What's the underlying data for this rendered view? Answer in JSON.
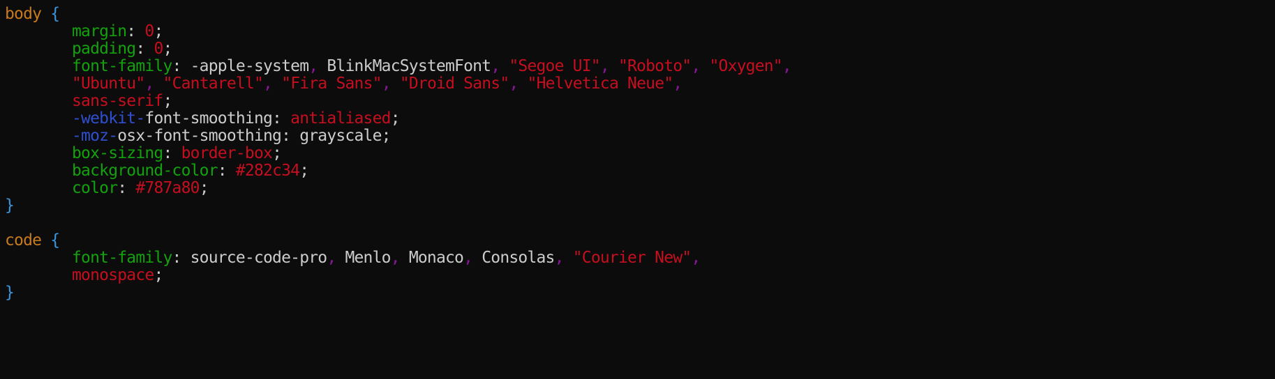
{
  "editor": {
    "background": "#0c0c0c",
    "palette": {
      "sel": "#c87a1e",
      "brace": "#3a96dd",
      "prop": "#13a10e",
      "val": "#c50f1f",
      "plain": "#cccccc",
      "vendor": "#2f4fd0",
      "comma": "#881798"
    },
    "lines": [
      {
        "indent": 0,
        "tokens": [
          [
            "sel",
            "body"
          ],
          [
            "plain",
            " "
          ],
          [
            "brace",
            "{"
          ]
        ]
      },
      {
        "indent": 1,
        "tokens": [
          [
            "prop",
            "margin"
          ],
          [
            "plain",
            ": "
          ],
          [
            "val",
            "0"
          ],
          [
            "plain",
            ";"
          ]
        ]
      },
      {
        "indent": 1,
        "tokens": [
          [
            "prop",
            "padding"
          ],
          [
            "plain",
            ": "
          ],
          [
            "val",
            "0"
          ],
          [
            "plain",
            ";"
          ]
        ]
      },
      {
        "indent": 1,
        "tokens": [
          [
            "prop",
            "font-family"
          ],
          [
            "plain",
            ": -apple-system"
          ],
          [
            "comma",
            ","
          ],
          [
            "plain",
            " BlinkMacSystemFont"
          ],
          [
            "comma",
            ","
          ],
          [
            "plain",
            " "
          ],
          [
            "val",
            "\"Segoe UI\""
          ],
          [
            "comma",
            ","
          ],
          [
            "plain",
            " "
          ],
          [
            "val",
            "\"Roboto\""
          ],
          [
            "comma",
            ","
          ],
          [
            "plain",
            " "
          ],
          [
            "val",
            "\"Oxygen\""
          ],
          [
            "comma",
            ","
          ]
        ]
      },
      {
        "indent": 1,
        "tokens": [
          [
            "val",
            "\"Ubuntu\""
          ],
          [
            "comma",
            ","
          ],
          [
            "plain",
            " "
          ],
          [
            "val",
            "\"Cantarell\""
          ],
          [
            "comma",
            ","
          ],
          [
            "plain",
            " "
          ],
          [
            "val",
            "\"Fira Sans\""
          ],
          [
            "comma",
            ","
          ],
          [
            "plain",
            " "
          ],
          [
            "val",
            "\"Droid Sans\""
          ],
          [
            "comma",
            ","
          ],
          [
            "plain",
            " "
          ],
          [
            "val",
            "\"Helvetica Neue\""
          ],
          [
            "comma",
            ","
          ]
        ]
      },
      {
        "indent": 1,
        "tokens": [
          [
            "val",
            "sans-serif"
          ],
          [
            "plain",
            ";"
          ]
        ]
      },
      {
        "indent": 1,
        "tokens": [
          [
            "vendor",
            "-webkit-"
          ],
          [
            "plain",
            "font-smoothing: "
          ],
          [
            "val",
            "antialiased"
          ],
          [
            "plain",
            ";"
          ]
        ]
      },
      {
        "indent": 1,
        "tokens": [
          [
            "vendor",
            "-moz-"
          ],
          [
            "plain",
            "osx-font-smoothing: grayscale;"
          ]
        ]
      },
      {
        "indent": 1,
        "tokens": [
          [
            "prop",
            "box-sizing"
          ],
          [
            "plain",
            ": "
          ],
          [
            "val",
            "border-box"
          ],
          [
            "plain",
            ";"
          ]
        ]
      },
      {
        "indent": 1,
        "tokens": [
          [
            "prop",
            "background-color"
          ],
          [
            "plain",
            ": "
          ],
          [
            "val",
            "#282c34"
          ],
          [
            "plain",
            ";"
          ]
        ]
      },
      {
        "indent": 1,
        "tokens": [
          [
            "prop",
            "color"
          ],
          [
            "plain",
            ": "
          ],
          [
            "val",
            "#787a80"
          ],
          [
            "plain",
            ";"
          ]
        ]
      },
      {
        "indent": 0,
        "tokens": [
          [
            "brace",
            "}"
          ]
        ]
      },
      {
        "indent": 0,
        "tokens": []
      },
      {
        "indent": 0,
        "tokens": [
          [
            "sel",
            "code"
          ],
          [
            "plain",
            " "
          ],
          [
            "brace",
            "{"
          ]
        ]
      },
      {
        "indent": 1,
        "tokens": [
          [
            "prop",
            "font-family"
          ],
          [
            "plain",
            ": source-code-pro"
          ],
          [
            "comma",
            ","
          ],
          [
            "plain",
            " Menlo"
          ],
          [
            "comma",
            ","
          ],
          [
            "plain",
            " Monaco"
          ],
          [
            "comma",
            ","
          ],
          [
            "plain",
            " Consolas"
          ],
          [
            "comma",
            ","
          ],
          [
            "plain",
            " "
          ],
          [
            "val",
            "\"Courier New\""
          ],
          [
            "comma",
            ","
          ]
        ]
      },
      {
        "indent": 1,
        "tokens": [
          [
            "val",
            "monospace"
          ],
          [
            "plain",
            ";"
          ]
        ]
      },
      {
        "indent": 0,
        "tokens": [
          [
            "brace",
            "}"
          ]
        ]
      }
    ]
  }
}
